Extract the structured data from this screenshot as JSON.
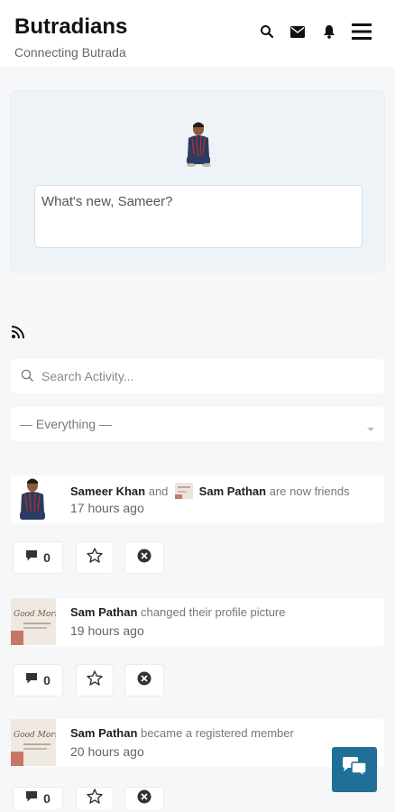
{
  "header": {
    "title": "Butradians",
    "tagline": "Connecting Butrada"
  },
  "post_box": {
    "placeholder": "What's new, Sameer?"
  },
  "activity_filters": {
    "search_placeholder": "Search Activity...",
    "filter_selected": "— Everything —"
  },
  "activities": [
    {
      "actor": "Sameer Khan",
      "connector": "and",
      "target": "Sam Pathan",
      "action": "are now friends",
      "time": "17 hours ago",
      "comments": "0"
    },
    {
      "actor": "Sam Pathan",
      "action": "changed their profile picture",
      "time": "19 hours ago",
      "comments": "0",
      "avatar_text": "Good Morning"
    },
    {
      "actor": "Sam Pathan",
      "action": "became a registered member",
      "time": "20 hours ago",
      "comments": "0",
      "avatar_text": "Good Morning"
    }
  ],
  "colors": {
    "accent": "#1f6f96",
    "page_bg": "#f6f7f8",
    "post_box_bg": "#eef3f7"
  },
  "icons": [
    "search-icon",
    "mail-icon",
    "bell-icon",
    "menu-icon",
    "rss-icon",
    "comment-icon",
    "star-icon",
    "close-circle-icon",
    "chat-icon"
  ]
}
